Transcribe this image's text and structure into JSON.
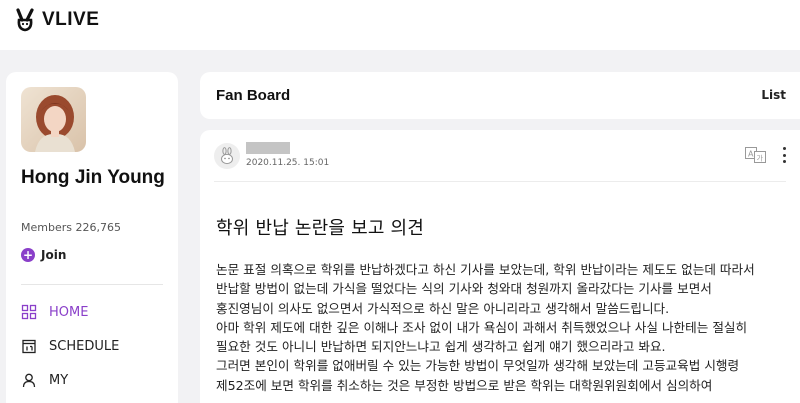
{
  "topbar": {
    "logo_text": "VLIVE"
  },
  "sidebar": {
    "artist_name": "Hong Jin Young",
    "members": "Members 226,765",
    "join_label": "Join",
    "nav": [
      {
        "label": "HOME",
        "icon": "grid-icon",
        "active": true
      },
      {
        "label": "SCHEDULE",
        "icon": "calendar-icon",
        "active": false
      },
      {
        "label": "MY",
        "icon": "person-icon",
        "active": false
      }
    ]
  },
  "board": {
    "title": "Fan Board",
    "list_label": "List"
  },
  "post": {
    "date": "2020.11.25. 15:01",
    "title": "학위 반납 논란을 보고 의견",
    "body": [
      "논문 표절 의혹으로 학위를 반납하겠다고 하신 기사를 보았는데, 학위 반납이라는 제도도 없는데 따라서",
      "반납할 방법이 없는데 가식을 떨었다는 식의 기사와 청와대 청원까지 올라갔다는 기사를 보면서",
      "홍진영님이 의사도 없으면서 가식적으로 하신 말은 아니리라고 생각해서 말씀드립니다.",
      "아마 학위 제도에 대한 깊은 이해나 조사 없이 내가 욕심이 과해서 취득했었으나 사실 나한테는 절실히",
      "필요한 것도 아니니 반납하면 되지안느냐고 쉽게 생각하고 쉽게 얘기 했으리라고 봐요.",
      "그러면 본인이 학위를 없애버릴 수 있는 가능한 방법이 무엇일까 생각해 보았는데 고등교육법 시행령",
      "제52조에 보면 학위를 취소하는 것은 부정한 방법으로 받은 학위는 대학원위원회에서 심의하여"
    ]
  },
  "colors": {
    "accent": "#8a3fc9",
    "background": "#f2f2f4"
  }
}
